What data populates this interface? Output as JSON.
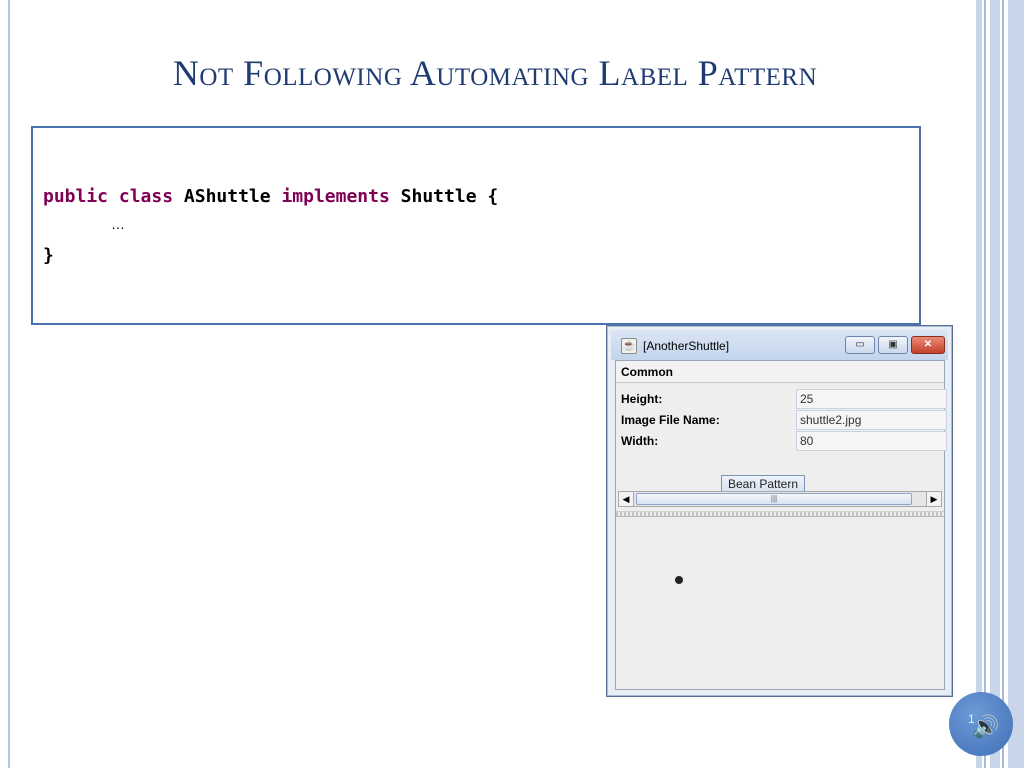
{
  "slide": {
    "title": "Not Following Automating Label Pattern",
    "slide_number": "1"
  },
  "code": {
    "kw_public": "public",
    "kw_class": "class",
    "class_name": "AShuttle",
    "kw_implements": "implements",
    "interface_name": "Shuttle",
    "open_brace": "{",
    "ellipsis": "…",
    "close_brace": "}"
  },
  "window": {
    "title": "[AnotherShuttle]",
    "menu": {
      "common": "Common"
    },
    "properties": [
      {
        "label": "Height:",
        "value": "25"
      },
      {
        "label": "Image File Name:",
        "value": "shuttle2.jpg"
      },
      {
        "label": "Width:",
        "value": "80"
      }
    ],
    "bean_pattern_button": "Bean Pattern",
    "scroll": {
      "left_arrow": "◀",
      "right_arrow": "▶",
      "thumb_grip": "|||"
    },
    "titlebar_buttons": {
      "minimize": "▭",
      "maximize": "▣",
      "close": "✕"
    }
  },
  "icons": {
    "app": "java-icon",
    "speaker": "speaker-icon"
  },
  "colors": {
    "title": "#1f3b72",
    "keyword": "#7f0055",
    "code_border": "#4a73ad"
  }
}
